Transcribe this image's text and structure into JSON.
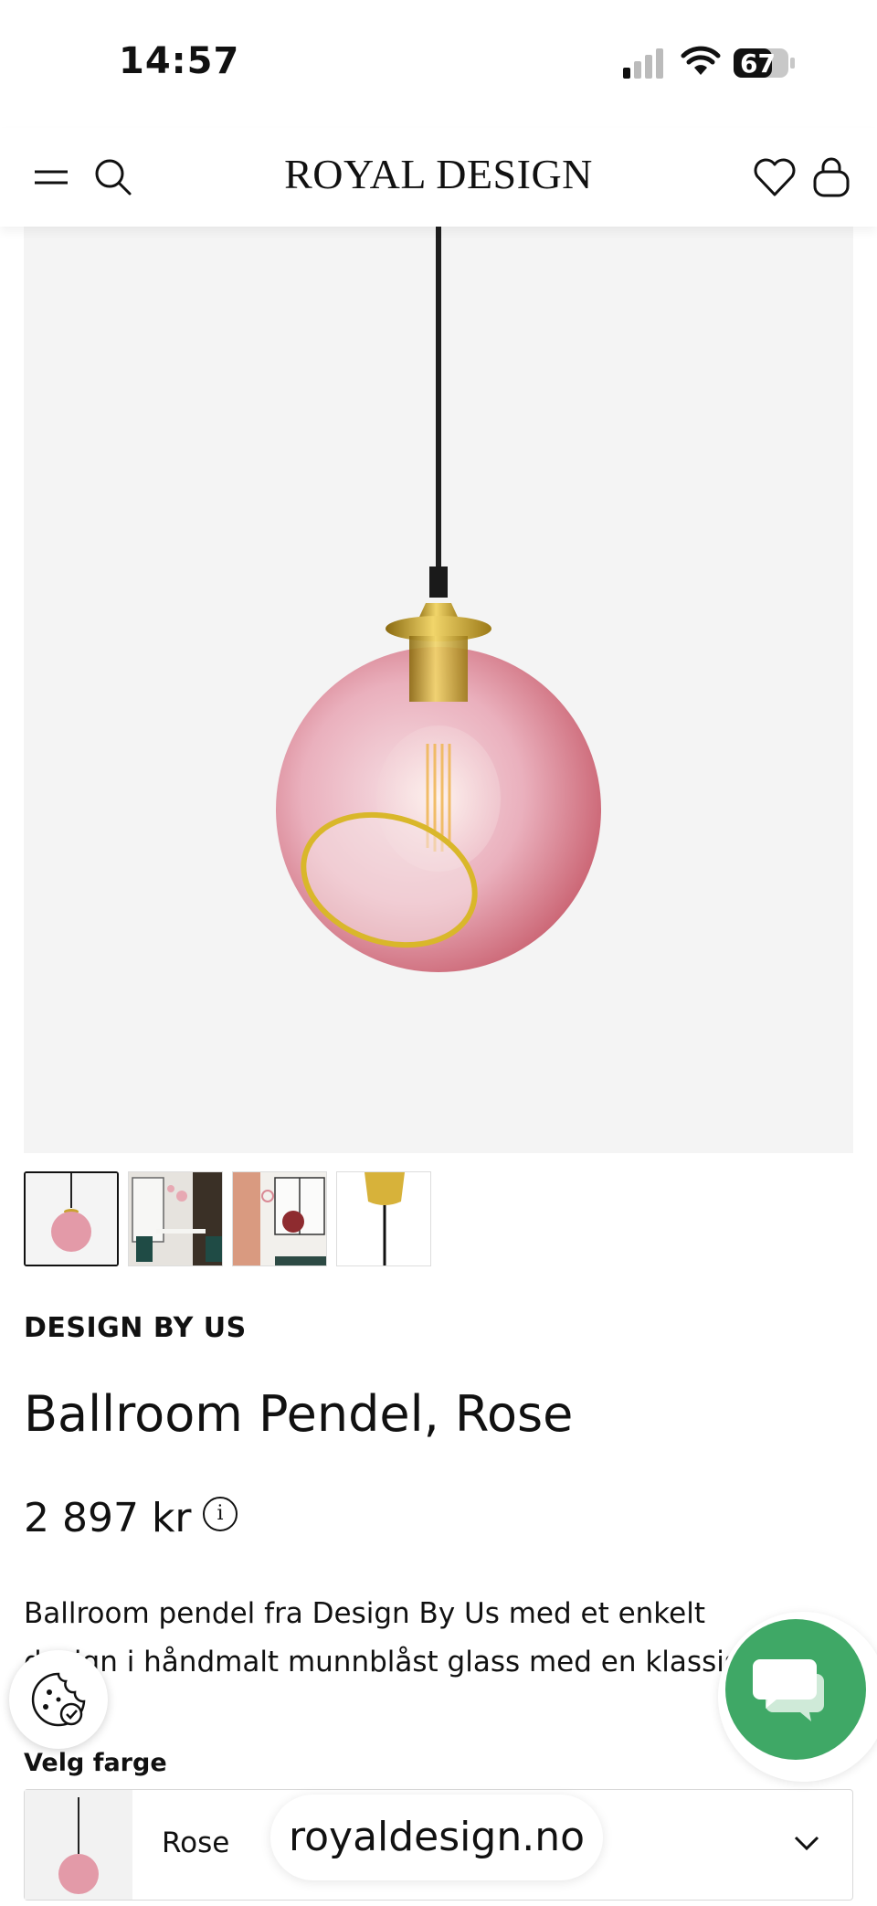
{
  "status": {
    "time": "14:57",
    "battery": "67"
  },
  "header": {
    "brand": "ROYAL DESIGN"
  },
  "product": {
    "brand": "DESIGN BY US",
    "title": "Ballroom Pendel, Rose",
    "price": "2 897 kr",
    "description": "Ballroom pendel fra Design By Us med et enkelt design i håndmalt munnblåst glass med en klassisk form."
  },
  "gallery": {
    "thumbnail_count": 4,
    "active_index": 0
  },
  "options": {
    "color_label": "Velg farge",
    "color_value": "Rose"
  },
  "browser": {
    "url": "royaldesign.no"
  },
  "colors": {
    "chat_green": "#3fa866",
    "glass_pink": "#e39aa8",
    "brass": "#c9a230",
    "hero_bg": "#f4f4f4"
  },
  "icons": [
    "menu-icon",
    "search-icon",
    "heart-icon",
    "bag-icon",
    "info-icon",
    "cookie-icon",
    "chat-icon",
    "chevron-down-icon"
  ]
}
